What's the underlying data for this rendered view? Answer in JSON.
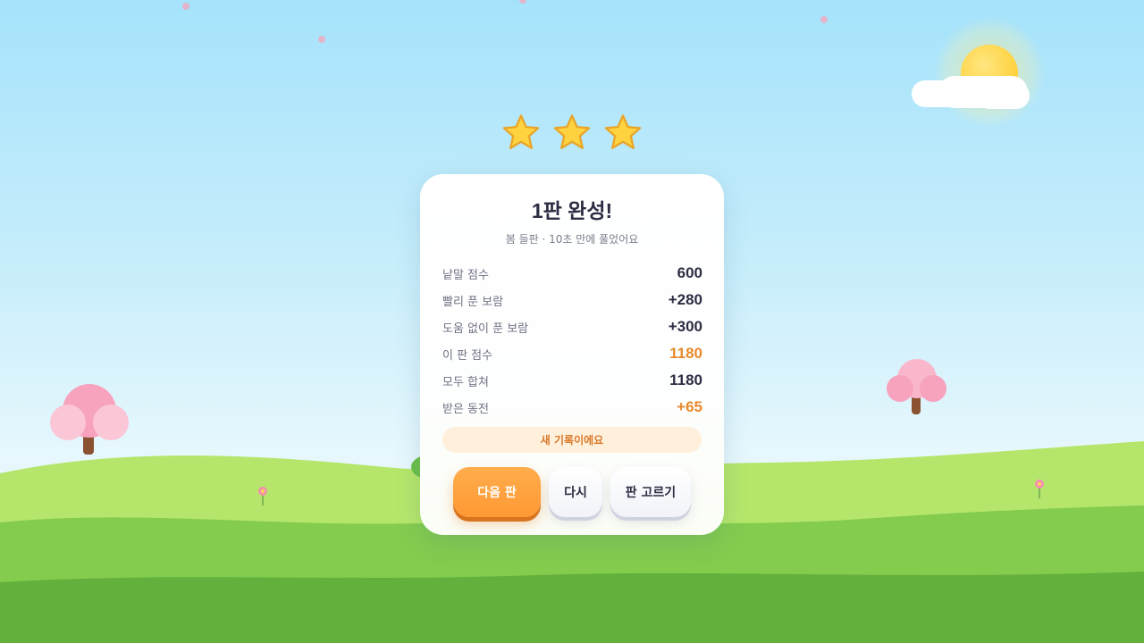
{
  "result": {
    "title": "1판 완성!",
    "subtitle": "봄 들판 · 10초 만에 풀었어요",
    "stars_earned": 3,
    "stars_total": 3,
    "rows": [
      {
        "label": "낱말 점수",
        "value": "600",
        "highlight": false
      },
      {
        "label": "빨리 푼 보람",
        "value": "+280",
        "highlight": false
      },
      {
        "label": "도움 없이 푼 보람",
        "value": "+300",
        "highlight": false
      },
      {
        "label": "이 판 점수",
        "value": "1180",
        "highlight": true
      },
      {
        "label": "모두 합쳐",
        "value": "1180",
        "highlight": false
      },
      {
        "label": "받은 동전",
        "value": "+65",
        "highlight": true
      }
    ],
    "record_badge": "새 기록이에요"
  },
  "buttons": {
    "next": "다음 판",
    "retry": "다시",
    "levels": "판 고르기"
  },
  "colors": {
    "accent_orange": "#ff9f3d",
    "highlight_text": "#e8892b",
    "star_fill": "#ffd23f",
    "sky_top": "#a6e3fb",
    "grass": "#84cc4e"
  },
  "icons": [
    "star-icon",
    "sun-icon",
    "cloud-icon",
    "tree-icon",
    "flower-icon"
  ]
}
